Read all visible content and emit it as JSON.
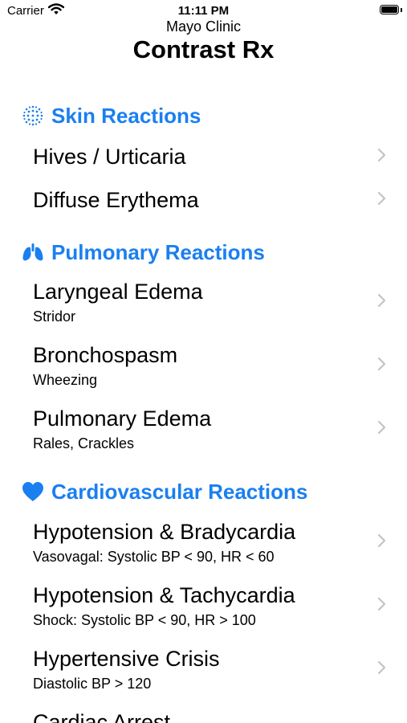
{
  "status_bar": {
    "carrier": "Carrier",
    "time": "11:11 PM"
  },
  "header": {
    "subtitle": "Mayo Clinic",
    "title": "Contrast Rx"
  },
  "sections": [
    {
      "title": "Skin Reactions",
      "icon": "dots-pattern-icon",
      "items": [
        {
          "title": "Hives / Urticaria"
        },
        {
          "title": "Diffuse Erythema"
        }
      ]
    },
    {
      "title": "Pulmonary Reactions",
      "icon": "lungs-icon",
      "items": [
        {
          "title": "Laryngeal Edema",
          "subtitle": "Stridor"
        },
        {
          "title": "Bronchospasm",
          "subtitle": "Wheezing"
        },
        {
          "title": "Pulmonary Edema",
          "subtitle": "Rales, Crackles"
        }
      ]
    },
    {
      "title": "Cardiovascular Reactions",
      "icon": "heart-icon",
      "items": [
        {
          "title": "Hypotension & Bradycardia",
          "subtitle": "Vasovagal: Systolic BP < 90, HR < 60"
        },
        {
          "title": "Hypotension & Tachycardia",
          "subtitle": "Shock: Systolic BP < 90, HR > 100"
        },
        {
          "title": "Hypertensive Crisis",
          "subtitle": "Diastolic BP > 120"
        },
        {
          "title": "Cardiac Arrest"
        }
      ]
    }
  ],
  "colors": {
    "accent": "#1a7ff0",
    "chevron": "#c4c4c7",
    "text": "#000000"
  }
}
